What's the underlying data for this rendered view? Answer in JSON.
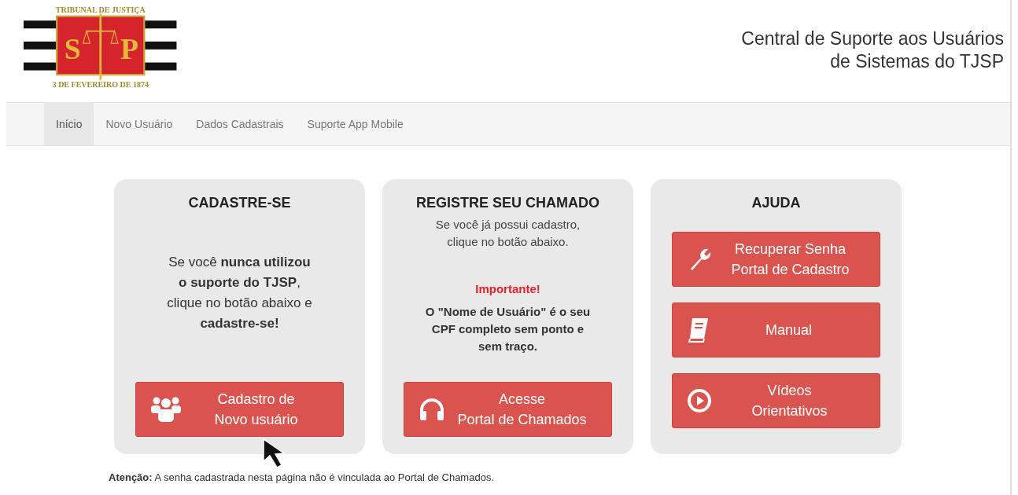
{
  "logo": {
    "top_text": "TRIBUNAL DE JUSTIÇA",
    "left_letter": "S",
    "right_letter": "P",
    "bottom_text": "3 DE FEVEREIRO DE 1874"
  },
  "site_title": [
    "Central de Suporte aos Usuários",
    "de Sistemas do TJSP"
  ],
  "nav": [
    {
      "label": "Início",
      "selected": true
    },
    {
      "label": "Novo Usuário",
      "selected": false
    },
    {
      "label": "Dados Cadastrais",
      "selected": false
    },
    {
      "label": "Suporte App Mobile",
      "selected": false
    }
  ],
  "cards": [
    {
      "title": "CADASTRE-SE",
      "blocks": [
        {
          "kind": "text",
          "lines": [
            "Se você **nunca utilizou**",
            "**o suporte do TJSP**,",
            "clique no botão abaixo e",
            "**cadastre-se!**"
          ]
        }
      ],
      "buttons": [
        {
          "kind": "users",
          "lines": [
            "Cadastro de",
            "Novo usuário"
          ]
        }
      ]
    },
    {
      "title": "REGISTRE SEU CHAMADO",
      "blocks": [
        {
          "kind": "intro",
          "lines": [
            "Se você já possui cadastro,",
            "clique no botão abaixo."
          ]
        },
        {
          "kind": "important",
          "lines": [
            "Importante!"
          ]
        },
        {
          "kind": "note",
          "lines": [
            "O \"Nome de Usuário\" é o seu",
            "CPF completo sem ponto e",
            "sem traço."
          ]
        }
      ],
      "buttons": [
        {
          "kind": "headset",
          "lines": [
            "Acesse",
            "Portal de Chamados"
          ]
        }
      ]
    },
    {
      "title": "AJUDA",
      "buttons": [
        {
          "kind": "wrench",
          "lines": [
            "Recuperar Senha",
            "Portal de Cadastro"
          ]
        },
        {
          "kind": "book",
          "lines": [
            "Manual"
          ]
        },
        {
          "kind": "play",
          "lines": [
            "Vídeos",
            "Orientativos"
          ]
        }
      ]
    }
  ],
  "notice": "**Atenção:** A senha cadastrada nesta página não é vinculada ao Portal de Chamados."
}
